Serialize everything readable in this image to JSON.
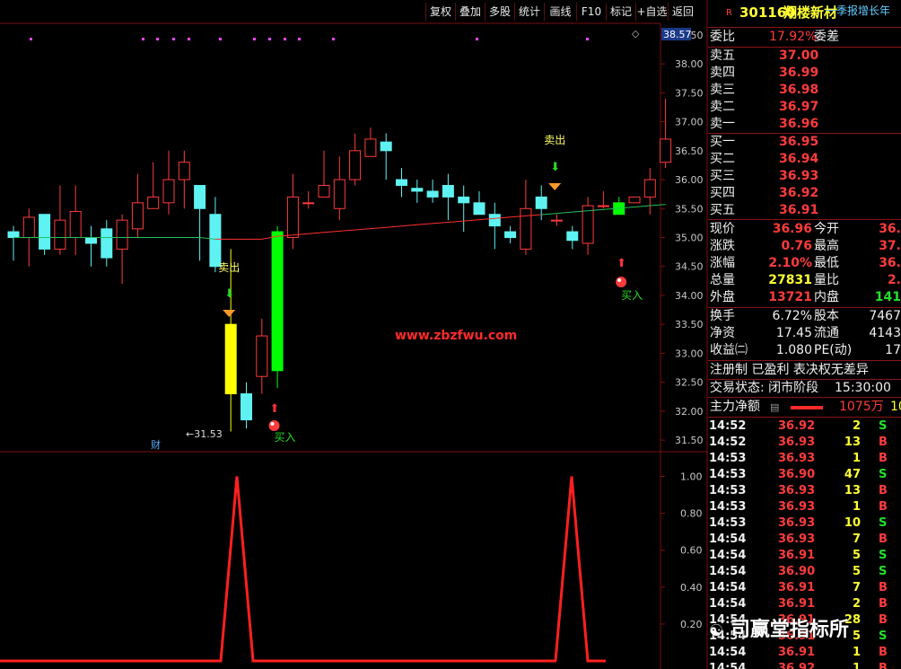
{
  "toolbar": {
    "buttons": [
      "复权",
      "叠加",
      "多股",
      "统计",
      "画线",
      "F10",
      "标记",
      "+自选",
      "返回"
    ]
  },
  "stock": {
    "flag": "R",
    "code": "301160",
    "name": "翔楼新材",
    "scroll_text": "一季报增长年"
  },
  "quote": {
    "weibi_label": "委比",
    "weibi_value": "17.92%",
    "weicha_label": "委差",
    "sell": [
      {
        "label": "卖五",
        "price": "37.00"
      },
      {
        "label": "卖四",
        "price": "36.99"
      },
      {
        "label": "卖三",
        "price": "36.98"
      },
      {
        "label": "卖二",
        "price": "36.97"
      },
      {
        "label": "卖一",
        "price": "36.96"
      }
    ],
    "buy": [
      {
        "label": "买一",
        "price": "36.95"
      },
      {
        "label": "买二",
        "price": "36.94"
      },
      {
        "label": "买三",
        "price": "36.93"
      },
      {
        "label": "买四",
        "price": "36.92"
      },
      {
        "label": "买五",
        "price": "36.91"
      }
    ],
    "stats": [
      {
        "l1": "现价",
        "v1": "36.96",
        "l2": "今开",
        "v2": "36."
      },
      {
        "l1": "涨跌",
        "v1": "0.76",
        "l2": "最高",
        "v2": "37."
      },
      {
        "l1": "涨幅",
        "v1": "2.10%",
        "l2": "最低",
        "v2": "36."
      },
      {
        "l1": "总量",
        "v1": "27831",
        "l2": "量比",
        "v2": "2."
      },
      {
        "l1": "外盘",
        "v1": "13721",
        "l2": "内盘",
        "v2": "141"
      }
    ],
    "fund": [
      {
        "l1": "换手",
        "v1": "6.72%",
        "l2": "股本",
        "v2": "7467"
      },
      {
        "l1": "净资",
        "v1": "17.45",
        "l2": "流通",
        "v2": "4143"
      },
      {
        "l1": "收益㈡",
        "v1": "1.080",
        "l2": "PE(动)",
        "v2": "17"
      }
    ],
    "info_line": "注册制 已盈利 表决权无差异",
    "trade_status_label": "交易状态: 闭市阶段",
    "trade_status_time": "15:30:00",
    "net_label": "主力净额",
    "net_value": "1075万",
    "net_tail": "10"
  },
  "ticks": [
    {
      "t": "14:52",
      "p": "36.92",
      "v": "2",
      "s": "S"
    },
    {
      "t": "14:52",
      "p": "36.93",
      "v": "13",
      "s": "B"
    },
    {
      "t": "14:53",
      "p": "36.93",
      "v": "1",
      "s": "B"
    },
    {
      "t": "14:53",
      "p": "36.90",
      "v": "47",
      "s": "S"
    },
    {
      "t": "14:53",
      "p": "36.93",
      "v": "13",
      "s": "B"
    },
    {
      "t": "14:53",
      "p": "36.93",
      "v": "1",
      "s": "B"
    },
    {
      "t": "14:53",
      "p": "36.93",
      "v": "10",
      "s": "S"
    },
    {
      "t": "14:54",
      "p": "36.93",
      "v": "7",
      "s": "B"
    },
    {
      "t": "14:54",
      "p": "36.91",
      "v": "5",
      "s": "S"
    },
    {
      "t": "14:54",
      "p": "36.90",
      "v": "5",
      "s": "S"
    },
    {
      "t": "14:54",
      "p": "36.91",
      "v": "7",
      "s": "B"
    },
    {
      "t": "14:54",
      "p": "36.91",
      "v": "2",
      "s": "B"
    },
    {
      "t": "14:54",
      "p": "36.91",
      "v": "28",
      "s": "B"
    },
    {
      "t": "14:54",
      "p": "36.91",
      "v": "5",
      "s": "S"
    },
    {
      "t": "14:54",
      "p": "36.91",
      "v": "1",
      "s": "B"
    },
    {
      "t": "14:54",
      "p": "36.92",
      "v": "1",
      "s": "B"
    }
  ],
  "chart_data": [
    {
      "type": "candlestick",
      "ylim": [
        31.3,
        38.7
      ],
      "price_ticks": [
        "38.50",
        "38.00",
        "37.50",
        "37.00",
        "36.50",
        "36.00",
        "35.50",
        "35.00",
        "34.50",
        "34.00",
        "33.50",
        "33.00",
        "32.50",
        "32.00",
        "31.50"
      ],
      "current_price_tag": "38.57",
      "low_annotation": "31.53",
      "watermark_text": "www.zbzfwu.com",
      "finance_marker": "财",
      "signals": {
        "sell": "卖出",
        "buy": "买入"
      },
      "candles": [
        [
          35.1,
          35.0,
          34.6,
          35.2
        ],
        [
          35.0,
          35.35,
          34.5,
          35.5
        ],
        [
          35.4,
          34.8,
          34.7,
          35.4
        ],
        [
          34.8,
          35.3,
          34.7,
          35.9
        ],
        [
          35.0,
          35.45,
          34.7,
          35.9
        ],
        [
          35.0,
          34.9,
          34.5,
          35.2
        ],
        [
          35.15,
          34.65,
          34.5,
          35.3
        ],
        [
          34.8,
          35.3,
          34.2,
          35.4
        ],
        [
          35.15,
          35.6,
          35.0,
          36.1
        ],
        [
          35.5,
          35.7,
          35.5,
          36.3
        ],
        [
          35.6,
          36.0,
          35.4,
          36.5
        ],
        [
          36.0,
          36.3,
          35.5,
          36.5
        ],
        [
          35.9,
          35.5,
          34.6,
          35.9
        ],
        [
          35.4,
          34.5,
          34.4,
          35.7
        ],
        [
          33.5,
          32.3,
          31.65,
          34.8
        ],
        [
          32.3,
          31.85,
          31.7,
          32.5
        ],
        [
          32.6,
          33.3,
          32.3,
          33.6
        ],
        [
          32.7,
          35.1,
          32.4,
          35.2
        ],
        [
          35.0,
          35.7,
          34.8,
          36.1
        ],
        [
          35.6,
          35.6,
          35.5,
          35.8
        ],
        [
          35.7,
          35.9,
          35.7,
          36.5
        ],
        [
          35.5,
          36.0,
          35.3,
          36.4
        ],
        [
          36.0,
          36.5,
          35.9,
          36.8
        ],
        [
          36.4,
          36.7,
          36.5,
          36.9
        ],
        [
          36.65,
          36.5,
          36.0,
          36.8
        ],
        [
          36.0,
          35.9,
          35.7,
          36.2
        ],
        [
          35.85,
          35.8,
          35.6,
          36.0
        ],
        [
          35.8,
          35.7,
          35.6,
          36.0
        ],
        [
          35.9,
          35.7,
          35.3,
          36.1
        ],
        [
          35.7,
          35.6,
          35.1,
          35.9
        ],
        [
          35.6,
          35.4,
          35.4,
          35.8
        ],
        [
          35.4,
          35.2,
          34.8,
          35.6
        ],
        [
          35.1,
          35.0,
          34.9,
          35.2
        ],
        [
          34.8,
          35.5,
          34.7,
          36.0
        ],
        [
          35.7,
          35.5,
          35.3,
          35.9
        ],
        [
          35.3,
          35.3,
          35.2,
          35.4
        ],
        [
          35.1,
          34.95,
          34.8,
          35.2
        ],
        [
          34.9,
          35.55,
          34.7,
          35.7
        ],
        [
          35.55,
          35.55,
          35.5,
          35.8
        ],
        [
          35.4,
          35.6,
          35.4,
          35.7
        ],
        [
          35.6,
          35.7,
          35.6,
          35.7
        ],
        [
          35.7,
          36.0,
          35.4,
          36.2
        ],
        [
          36.3,
          36.7,
          36.2,
          37.4
        ]
      ]
    },
    {
      "type": "line",
      "ylim": [
        0,
        1.1
      ],
      "y_ticks": [
        "1.00",
        "0.80",
        "0.60",
        "0.40",
        "0.20"
      ],
      "values": [
        0,
        0,
        0,
        0,
        0,
        0,
        0,
        0,
        0,
        0,
        0,
        0,
        0,
        0,
        0,
        0,
        0,
        1,
        0,
        0,
        0,
        0,
        0,
        0,
        0,
        0,
        0,
        0,
        0,
        0,
        0,
        0,
        0,
        0,
        0,
        0,
        0,
        0,
        0,
        0,
        1,
        0,
        0
      ]
    }
  ],
  "overlay_watermark": "司赢堂指标所",
  "colors": {
    "up": "#ff3b3b",
    "down": "#5ef2f2",
    "ma": "#ff3030",
    "ma_recent": "#22c05a",
    "signal_up": "#00ff00",
    "signal_down": "#ffff00",
    "grid": "#7a1010"
  }
}
